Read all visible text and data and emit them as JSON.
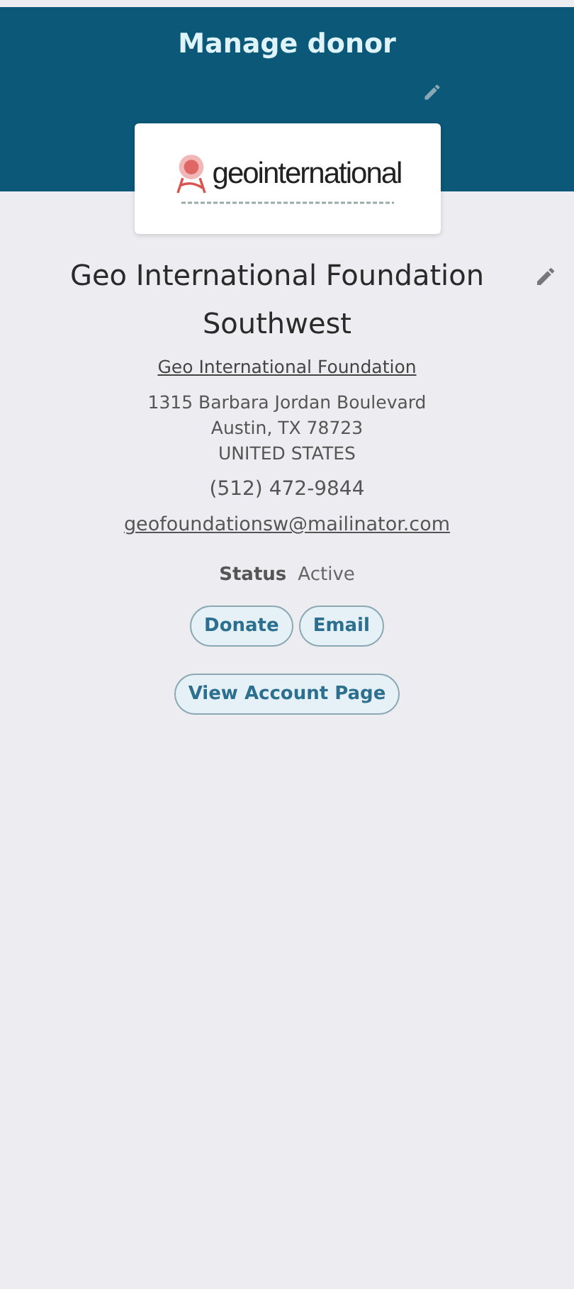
{
  "header": {
    "title": "Manage donor"
  },
  "logo": {
    "text": "geointernational"
  },
  "donor": {
    "name": "Geo International Foundation Southwest",
    "parent_link": "Geo International Foundation",
    "address_lines": [
      "1315 Barbara Jordan Boulevard",
      "Austin, TX 78723",
      "UNITED STATES"
    ],
    "phone": "(512) 472-9844",
    "email": "geofoundationsw@mailinator.com"
  },
  "status": {
    "label": "Status",
    "value": "Active"
  },
  "actions": [
    [
      "Donate",
      "Email"
    ],
    [
      "View Account Page"
    ]
  ]
}
